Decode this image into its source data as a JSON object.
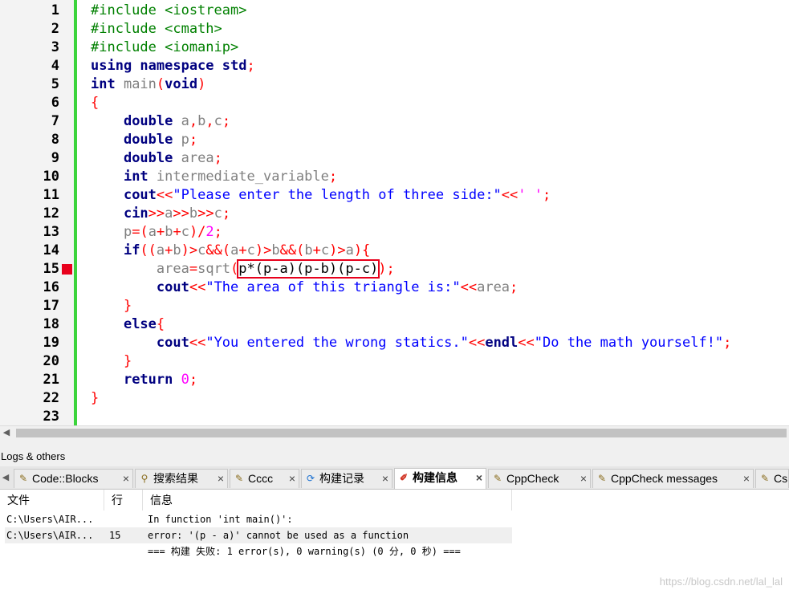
{
  "editor": {
    "lines": [
      {
        "n": "1",
        "tokens": [
          [
            "pp",
            "#include <iostream>"
          ]
        ]
      },
      {
        "n": "2",
        "tokens": [
          [
            "pp",
            "#include <cmath>"
          ]
        ]
      },
      {
        "n": "3",
        "tokens": [
          [
            "pp",
            "#include <iomanip>"
          ]
        ]
      },
      {
        "n": "4",
        "tokens": [
          [
            "kw",
            "using namespace std"
          ],
          [
            "op",
            ";"
          ]
        ]
      },
      {
        "n": "5",
        "tokens": [
          [
            "kw",
            "int "
          ],
          [
            "id",
            "main"
          ],
          [
            "op",
            "("
          ],
          [
            "kw",
            "void"
          ],
          [
            "op",
            ")"
          ]
        ]
      },
      {
        "n": "6",
        "tokens": [
          [
            "op",
            "{"
          ]
        ]
      },
      {
        "n": "7",
        "tokens": [
          [
            "",
            "    "
          ],
          [
            "kw",
            "double "
          ],
          [
            "id",
            "a"
          ],
          [
            "op",
            ","
          ],
          [
            "id",
            "b"
          ],
          [
            "op",
            ","
          ],
          [
            "id",
            "c"
          ],
          [
            "op",
            ";"
          ]
        ]
      },
      {
        "n": "8",
        "tokens": [
          [
            "",
            "    "
          ],
          [
            "kw",
            "double "
          ],
          [
            "id",
            "p"
          ],
          [
            "op",
            ";"
          ]
        ]
      },
      {
        "n": "9",
        "tokens": [
          [
            "",
            "    "
          ],
          [
            "kw",
            "double "
          ],
          [
            "id",
            "area"
          ],
          [
            "op",
            ";"
          ]
        ]
      },
      {
        "n": "10",
        "tokens": [
          [
            "",
            "    "
          ],
          [
            "kw",
            "int "
          ],
          [
            "id",
            "intermediate_variable"
          ],
          [
            "op",
            ";"
          ]
        ]
      },
      {
        "n": "11",
        "tokens": [
          [
            "",
            "    "
          ],
          [
            "kwm",
            "cout"
          ],
          [
            "op",
            "<<"
          ],
          [
            "str",
            "\"Please enter the length of three side:\""
          ],
          [
            "op",
            "<<"
          ],
          [
            "ch",
            "' '"
          ],
          [
            "op",
            ";"
          ]
        ]
      },
      {
        "n": "12",
        "tokens": [
          [
            "",
            "    "
          ],
          [
            "kwm",
            "cin"
          ],
          [
            "op",
            ">>"
          ],
          [
            "id",
            "a"
          ],
          [
            "op",
            ">>"
          ],
          [
            "id",
            "b"
          ],
          [
            "op",
            ">>"
          ],
          [
            "id",
            "c"
          ],
          [
            "op",
            ";"
          ]
        ]
      },
      {
        "n": "13",
        "tokens": [
          [
            "",
            "    "
          ],
          [
            "id",
            "p"
          ],
          [
            "op",
            "=("
          ],
          [
            "id",
            "a"
          ],
          [
            "op",
            "+"
          ],
          [
            "id",
            "b"
          ],
          [
            "op",
            "+"
          ],
          [
            "id",
            "c"
          ],
          [
            "op",
            ")/"
          ],
          [
            "num",
            "2"
          ],
          [
            "op",
            ";"
          ]
        ]
      },
      {
        "n": "14",
        "tokens": [
          [
            "",
            "    "
          ],
          [
            "kw",
            "if"
          ],
          [
            "op",
            "(("
          ],
          [
            "id",
            "a"
          ],
          [
            "op",
            "+"
          ],
          [
            "id",
            "b"
          ],
          [
            "op",
            ")>"
          ],
          [
            "id",
            "c"
          ],
          [
            "op",
            "&&("
          ],
          [
            "id",
            "a"
          ],
          [
            "op",
            "+"
          ],
          [
            "id",
            "c"
          ],
          [
            "op",
            ")>"
          ],
          [
            "id",
            "b"
          ],
          [
            "op",
            "&&("
          ],
          [
            "id",
            "b"
          ],
          [
            "op",
            "+"
          ],
          [
            "id",
            "c"
          ],
          [
            "op",
            ")>"
          ],
          [
            "id",
            "a"
          ],
          [
            "op",
            "){"
          ]
        ]
      },
      {
        "n": "15",
        "marker": true,
        "tokens": [
          [
            "",
            "        "
          ],
          [
            "id",
            "area"
          ],
          [
            "op",
            "="
          ],
          [
            "id",
            "sqrt"
          ],
          [
            "op",
            "("
          ],
          [
            "hl",
            "p*(p-a)(p-b)(p-c)"
          ],
          [
            "op",
            ");"
          ]
        ]
      },
      {
        "n": "16",
        "tokens": [
          [
            "",
            "        "
          ],
          [
            "kwm",
            "cout"
          ],
          [
            "op",
            "<<"
          ],
          [
            "str",
            "\"The area of this triangle is:\""
          ],
          [
            "op",
            "<<"
          ],
          [
            "id",
            "area"
          ],
          [
            "op",
            ";"
          ]
        ]
      },
      {
        "n": "17",
        "tokens": [
          [
            "",
            "    "
          ],
          [
            "op",
            "}"
          ]
        ]
      },
      {
        "n": "18",
        "tokens": [
          [
            "",
            "    "
          ],
          [
            "kw",
            "else"
          ],
          [
            "op",
            "{"
          ]
        ]
      },
      {
        "n": "19",
        "tokens": [
          [
            "",
            "        "
          ],
          [
            "kwm",
            "cout"
          ],
          [
            "op",
            "<<"
          ],
          [
            "str",
            "\"You entered the wrong statics.\""
          ],
          [
            "op",
            "<<"
          ],
          [
            "kwm",
            "endl"
          ],
          [
            "op",
            "<<"
          ],
          [
            "str",
            "\"Do the math yourself!\""
          ],
          [
            "op",
            ";"
          ]
        ]
      },
      {
        "n": "20",
        "tokens": [
          [
            "",
            "    "
          ],
          [
            "op",
            "}"
          ]
        ]
      },
      {
        "n": "21",
        "tokens": [
          [
            "",
            "    "
          ],
          [
            "kw",
            "return "
          ],
          [
            "num",
            "0"
          ],
          [
            "op",
            ";"
          ]
        ]
      },
      {
        "n": "22",
        "tokens": [
          [
            "op",
            "}"
          ]
        ]
      },
      {
        "n": "23",
        "tokens": []
      }
    ]
  },
  "logs": {
    "title": "Logs & others",
    "tabs": [
      {
        "label": "Code::Blocks",
        "icon": "document-icon",
        "close": "×",
        "active": false
      },
      {
        "label": "搜索结果",
        "icon": "search-icon",
        "close": "×",
        "active": false
      },
      {
        "label": "Cccc",
        "icon": "document-icon",
        "close": "×",
        "active": false
      },
      {
        "label": "构建记录",
        "icon": "build-log-icon",
        "close": "×",
        "active": false
      },
      {
        "label": "构建信息",
        "icon": "build-messages-icon",
        "close": "×",
        "active": true
      },
      {
        "label": "CppCheck",
        "icon": "document-icon",
        "close": "×",
        "active": false
      },
      {
        "label": "CppCheck messages",
        "icon": "document-icon",
        "close": "×",
        "active": false
      },
      {
        "label": "Cs",
        "icon": "document-icon",
        "close": "",
        "active": false
      }
    ],
    "columns": [
      "文件",
      "行",
      "信息"
    ],
    "rows": [
      {
        "file": "C:\\Users\\AIR...",
        "line": "",
        "message": "In function 'int main()':"
      },
      {
        "file": "C:\\Users\\AIR...",
        "line": "15",
        "message": "error: '(p - a)' cannot be used as a function"
      },
      {
        "file": "",
        "line": "",
        "message": "=== 构建 失败: 1 error(s), 0 warning(s) (0 分, 0 秒) ==="
      }
    ]
  },
  "watermark": "https://blog.csdn.net/lal_lal"
}
